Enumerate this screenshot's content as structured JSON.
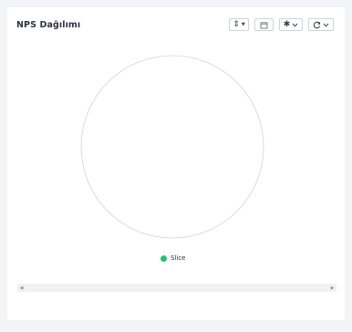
{
  "card": {
    "title": "NPS Dağılımı"
  },
  "toolbar": {
    "sort_icon": "sort-icon",
    "calendar_icon": "calendar-icon",
    "asterisk_icon": "asterisk-icon",
    "refresh_icon": "refresh-icon",
    "caret_icon": "chevron-down-icon"
  },
  "chart_data": {
    "type": "pie",
    "title": "NPS Dağılımı",
    "slices": [
      {
        "name": "Slice",
        "value": 0,
        "color": "#21c272"
      }
    ],
    "legend": {
      "placement": "bottom-center",
      "entries": [
        "Slice"
      ]
    },
    "empty_outline_color": "#d4d4d4"
  }
}
